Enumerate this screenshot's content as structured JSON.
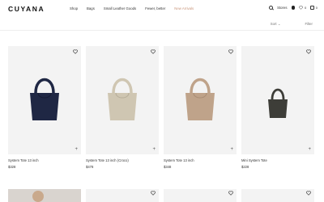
{
  "brand": {
    "logo": "CUYANA"
  },
  "nav": {
    "items": [
      {
        "label": "Shop"
      },
      {
        "label": "Bags"
      },
      {
        "label": "Small Leather Goods"
      },
      {
        "label": "Fewer, better"
      },
      {
        "label": "New Arrivals"
      }
    ]
  },
  "utility": {
    "stores_label": "Stores",
    "wishlist_count": "0",
    "bag_count": "0"
  },
  "toolbar": {
    "sort_label": "Sort",
    "filter_label": "Filter"
  },
  "products": [
    {
      "name": "System Tote 13 inch",
      "price": "$328",
      "color": "#1f2744"
    },
    {
      "name": "System Tote 13 inch (Croco)",
      "price": "$478",
      "color": "#cfc6b2"
    },
    {
      "name": "System Tote 13 inch",
      "price": "$348",
      "color": "#bfa38a"
    },
    {
      "name": "Mini System Tote",
      "price": "$228",
      "color": "#3d3d38"
    }
  ],
  "colors": {
    "accent_nav": "#c9957a"
  }
}
